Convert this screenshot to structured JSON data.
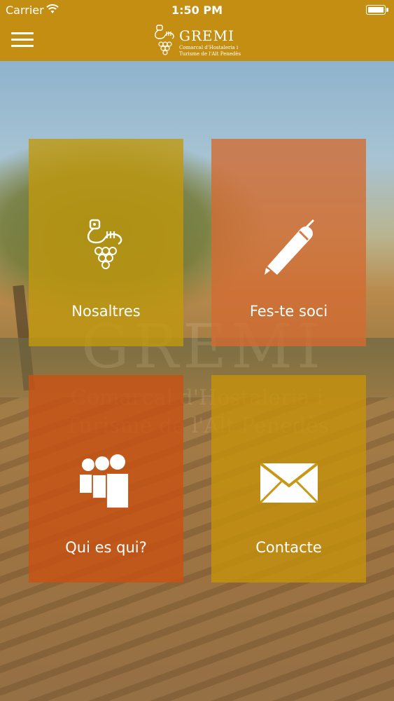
{
  "status_bar": {
    "carrier": "Carrier",
    "wifi_icon": "wifi-icon",
    "time": "1:50 PM",
    "battery_icon": "battery-icon"
  },
  "navbar": {
    "menu_icon": "hamburger-menu-icon",
    "logo": {
      "title": "GREMI",
      "subtitle_line1": "Comarcal d'Hostaleria i",
      "subtitle_line2": "Turisme de l'Alt Penedès"
    },
    "color": "#c38e12"
  },
  "background": {
    "watermark_title": "GREMI",
    "watermark_line1": "Comarcal d'Hostaleria i",
    "watermark_line2": "Turisme de l'Alt Penedès"
  },
  "tiles": [
    {
      "label": "Nosaltres",
      "icon": "grape-cup-logo-icon",
      "color": "#c1980e"
    },
    {
      "label": "Fes-te soci",
      "icon": "pen-icon",
      "color": "#d26c32"
    },
    {
      "label": "Qui es qui?",
      "icon": "people-group-icon",
      "color": "#c85214"
    },
    {
      "label": "Contacte",
      "icon": "envelope-icon",
      "color": "#c4910c"
    }
  ]
}
